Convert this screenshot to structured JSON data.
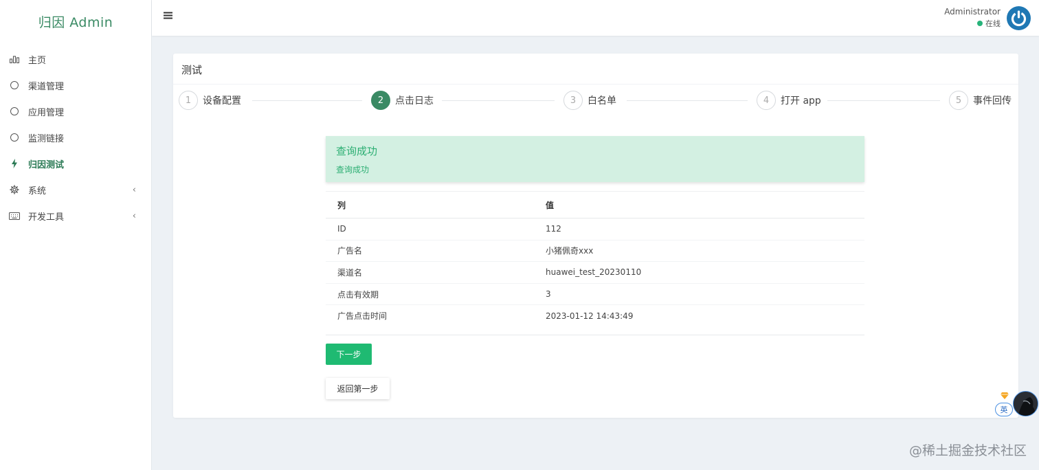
{
  "brand": "归因 Admin",
  "sidebar": {
    "items": [
      {
        "label": "主页",
        "icon": "bar-chart-icon"
      },
      {
        "label": "渠道管理",
        "icon": "circle-icon"
      },
      {
        "label": "应用管理",
        "icon": "circle-icon"
      },
      {
        "label": "监测链接",
        "icon": "circle-icon"
      },
      {
        "label": "归因测试",
        "icon": "bolt-icon",
        "active": true
      },
      {
        "label": "系统",
        "icon": "gear-icon",
        "has_children": true
      },
      {
        "label": "开发工具",
        "icon": "keyboard-icon",
        "has_children": true
      }
    ],
    "chevron": "‹"
  },
  "header": {
    "user_name": "Administrator",
    "user_status": "在线",
    "status_color": "#27b37a"
  },
  "card": {
    "title": "测试"
  },
  "steps": [
    {
      "num": "1",
      "label": "设备配置"
    },
    {
      "num": "2",
      "label": "点击日志",
      "active": true
    },
    {
      "num": "3",
      "label": "白名单"
    },
    {
      "num": "4",
      "label": "打开 app"
    },
    {
      "num": "5",
      "label": "事件回传"
    }
  ],
  "alert": {
    "title": "查询成功",
    "message": "查询成功"
  },
  "table": {
    "headers": [
      "列",
      "值"
    ],
    "rows": [
      [
        "ID",
        "112"
      ],
      [
        "广告名",
        "小猪佩奇xxx"
      ],
      [
        "渠道名",
        "huawei_test_20230110"
      ],
      [
        "点击有效期",
        "3"
      ],
      [
        "广告点击时间",
        "2023-01-12 14:43:49"
      ]
    ]
  },
  "buttons": {
    "next": "下一步",
    "back": "返回第一步"
  },
  "ime": {
    "label": "英"
  },
  "watermark": "@稀土掘金技术社区",
  "colors": {
    "accent": "#3a8a64",
    "success": "#1fba72",
    "alert_bg": "#d3f0e2"
  }
}
